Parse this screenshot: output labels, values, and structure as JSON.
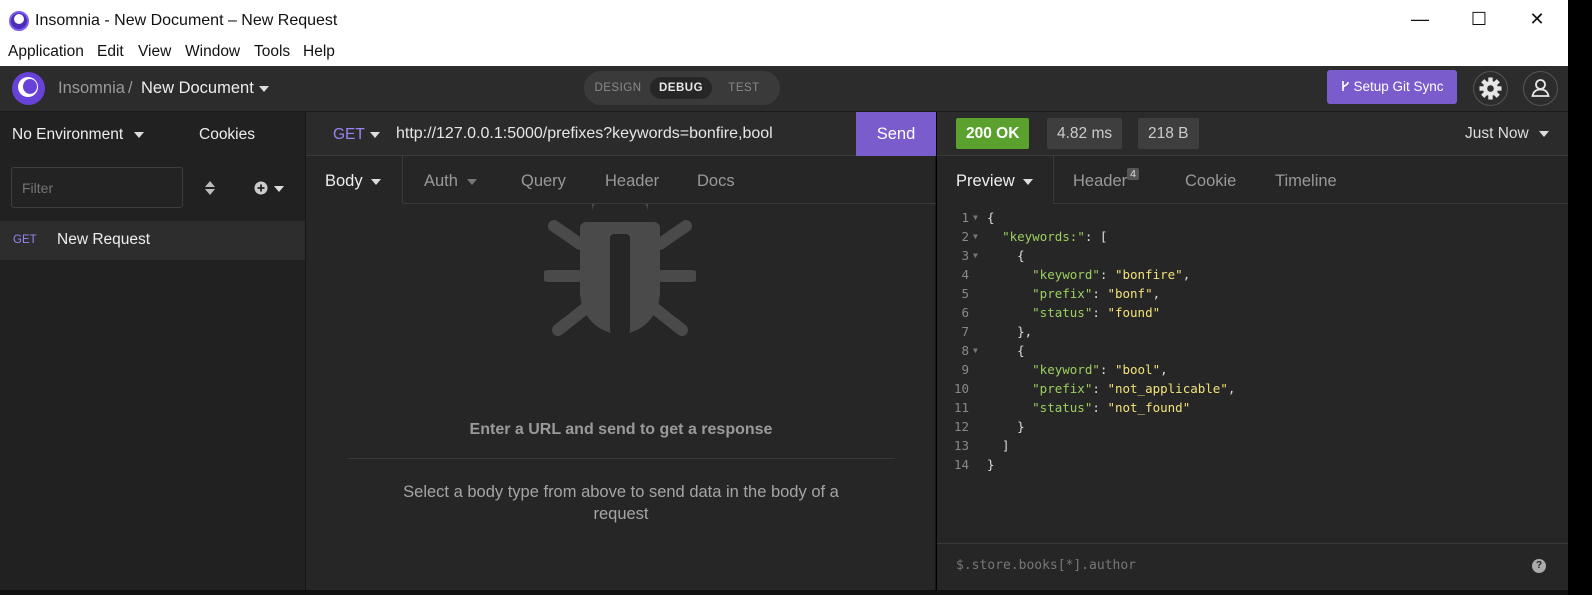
{
  "window": {
    "title": "Insomnia - New Document – New Request",
    "minimize": "—",
    "maximize": "☐",
    "close": "✕"
  },
  "menu": [
    "Application",
    "Edit",
    "View",
    "Window",
    "Tools",
    "Help"
  ],
  "header": {
    "workspace": "Insomnia",
    "separator": "/",
    "document": "New Document",
    "modes": [
      "DESIGN",
      "DEBUG",
      "TEST"
    ],
    "active_mode": "DEBUG",
    "git_sync": "Setup Git Sync"
  },
  "sidebar": {
    "environment": "No Environment",
    "cookies": "Cookies",
    "filter_placeholder": "Filter",
    "requests": [
      {
        "method": "GET",
        "name": "New Request"
      }
    ]
  },
  "request": {
    "method": "GET",
    "url": "http://127.0.0.1:5000/prefixes?keywords=bonfire,bool",
    "send": "Send",
    "tabs": [
      "Body",
      "Auth",
      "Query",
      "Header",
      "Docs"
    ],
    "empty_title": "Enter a URL and send to get a response",
    "empty_body": "Select a body type from above to send data in the body of a request"
  },
  "response": {
    "status": "200 OK",
    "time": "4.82 ms",
    "size": "218 B",
    "when": "Just Now",
    "tabs": [
      "Preview",
      "Header",
      "Cookie",
      "Timeline"
    ],
    "header_count": "4",
    "filter_placeholder": "$.store.books[*].author",
    "help": "?"
  },
  "colors": {
    "accent": "#7a5ccc",
    "status_ok": "#5aa22d",
    "json_key": "#9ccf5f",
    "json_string": "#f3e27a"
  }
}
